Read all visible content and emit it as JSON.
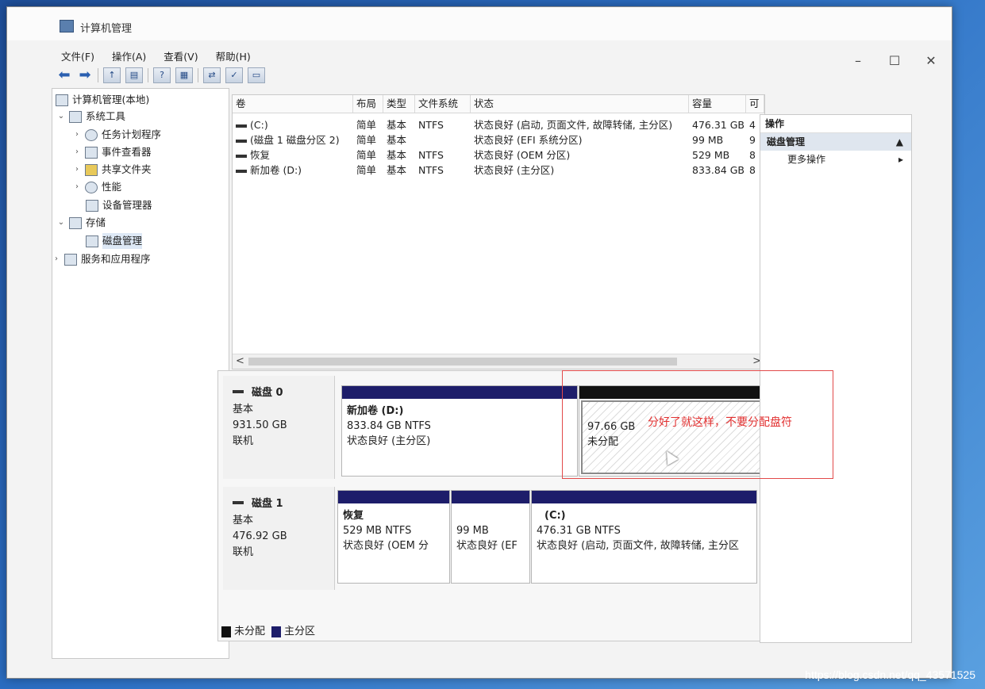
{
  "window": {
    "title": "计算机管理",
    "controls": {
      "minimize": "–",
      "maximize": "☐",
      "close": "✕"
    }
  },
  "menubar": [
    "文件(F)",
    "操作(A)",
    "查看(V)",
    "帮助(H)"
  ],
  "tree": {
    "root": "计算机管理(本地)",
    "system_tools": "系统工具",
    "task_scheduler": "任务计划程序",
    "event_viewer": "事件查看器",
    "shared_folders": "共享文件夹",
    "performance": "性能",
    "device_manager": "设备管理器",
    "storage": "存储",
    "disk_management": "磁盘管理",
    "services_apps": "服务和应用程序"
  },
  "volume_list": {
    "columns": [
      "卷",
      "布局",
      "类型",
      "文件系统",
      "状态",
      "容量",
      "可"
    ],
    "rows": [
      {
        "volume": "(C:)",
        "layout": "简单",
        "type": "基本",
        "fs": "NTFS",
        "status": "状态良好 (启动, 页面文件, 故障转储, 主分区)",
        "capacity": "476.31 GB",
        "free": "4"
      },
      {
        "volume": "(磁盘 1 磁盘分区 2)",
        "layout": "简单",
        "type": "基本",
        "fs": "",
        "status": "状态良好 (EFI 系统分区)",
        "capacity": "99 MB",
        "free": "9"
      },
      {
        "volume": "恢复",
        "layout": "简单",
        "type": "基本",
        "fs": "NTFS",
        "status": "状态良好 (OEM 分区)",
        "capacity": "529 MB",
        "free": "8"
      },
      {
        "volume": "新加卷 (D:)",
        "layout": "简单",
        "type": "基本",
        "fs": "NTFS",
        "status": "状态良好 (主分区)",
        "capacity": "833.84 GB",
        "free": "8"
      }
    ],
    "scroll_left": "<",
    "scroll_right": ">"
  },
  "disks": {
    "disk0": {
      "name": "磁盘 0",
      "type": "基本",
      "size": "931.50 GB",
      "state": "联机",
      "partitions": {
        "d": {
          "name": "新加卷 (D:)",
          "size_fs": "833.84 GB NTFS",
          "status": "状态良好 (主分区)"
        },
        "unalloc": {
          "size": "97.66 GB",
          "status": "未分配"
        }
      }
    },
    "disk1": {
      "name": "磁盘 1",
      "type": "基本",
      "size": "476.92 GB",
      "state": "联机",
      "partitions": {
        "recovery": {
          "name": "恢复",
          "size_fs": "529 MB NTFS",
          "status": "状态良好 (OEM 分"
        },
        "efi": {
          "size": "99 MB",
          "status": "状态良好 (EF"
        },
        "c": {
          "name": "(C:)",
          "size_fs": "476.31 GB NTFS",
          "status": "状态良好 (启动, 页面文件, 故障转储, 主分区"
        }
      }
    }
  },
  "legend": {
    "unallocated": "未分配",
    "primary": "主分区"
  },
  "legend_colors": {
    "unallocated": "#111111",
    "primary": "#1d1d6a"
  },
  "actions": {
    "header": "操作",
    "section": "磁盘管理",
    "more": "更多操作"
  },
  "annotation": "分好了就这样，不要分配盘符",
  "watermark": "https://blog.csdn.net/qq_43571525"
}
